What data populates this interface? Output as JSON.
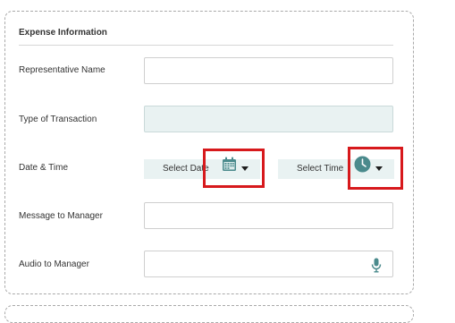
{
  "section": {
    "title": "Expense Information"
  },
  "fields": {
    "representative_name": {
      "label": "Representative Name",
      "value": ""
    },
    "transaction_type": {
      "label": "Type of Transaction",
      "value": ""
    },
    "date_time": {
      "label": "Date & Time",
      "date_button": "Select Date",
      "time_button": "Select Time"
    },
    "message_to_manager": {
      "label": "Message to Manager",
      "value": ""
    },
    "audio_to_manager": {
      "label": "Audio to Manager",
      "value": ""
    }
  },
  "icons": {
    "calendar": "calendar-icon",
    "clock": "clock-icon",
    "microphone": "microphone-icon",
    "dropdown": "caret-down-icon"
  },
  "colors": {
    "accent_teal": "#4a8a8c",
    "field_tint": "#e9f2f2",
    "highlight_red": "#d7191c"
  }
}
